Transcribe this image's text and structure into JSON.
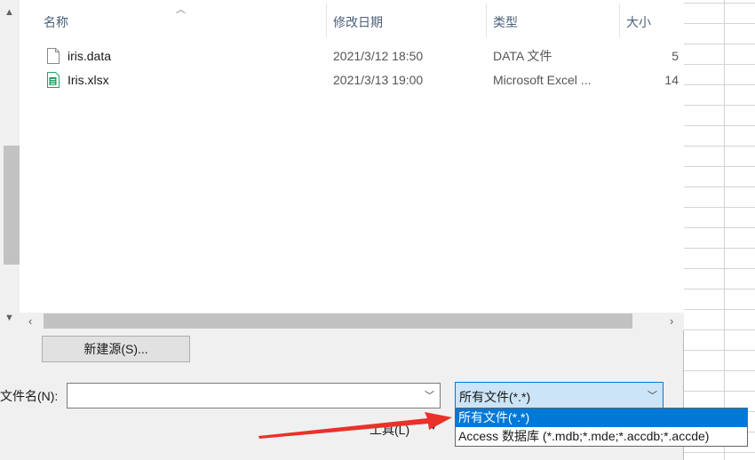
{
  "columns": {
    "name": "名称",
    "date": "修改日期",
    "type": "类型",
    "size": "大小"
  },
  "files": [
    {
      "name": "iris.data",
      "date": "2021/3/12 18:50",
      "type": "DATA 文件",
      "size": "5",
      "icon": "document-icon"
    },
    {
      "name": "Iris.xlsx",
      "date": "2021/3/13 19:00",
      "type": "Microsoft Excel ...",
      "size": "14",
      "icon": "excel-file-icon"
    }
  ],
  "new_source_label": "新建源(S)...",
  "filename": {
    "label": "文件名(N):",
    "value": ""
  },
  "filetype": {
    "selected": "所有文件(*.*)",
    "options": [
      "所有文件(*.*)",
      "Access 数据库 (*.mdb;*.mde;*.accdb;*.accde)"
    ]
  },
  "tools_label": "工具(L)",
  "colors": {
    "selection": "#0078d7",
    "combo_focus": "#cce4f7",
    "annotation_arrow": "#e8322a",
    "excel_green": "#21a366"
  }
}
